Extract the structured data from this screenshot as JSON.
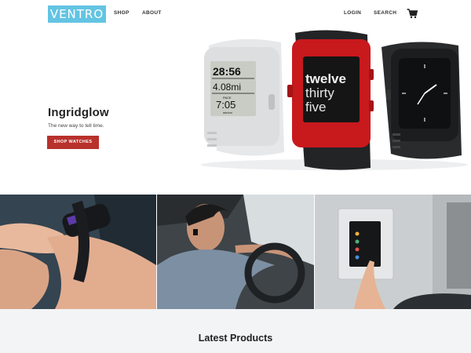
{
  "header": {
    "logo": "VENTRO",
    "nav": {
      "shop": "SHOP",
      "about": "ABOUT",
      "login": "LOGIN",
      "search": "SEARCH"
    }
  },
  "hero": {
    "title": "Ingridglow",
    "subtitle": "The new way to tell time.",
    "button": "SHOP WATCHES",
    "white_watch": {
      "time": "28:56",
      "distance": "4.08mi",
      "pace_label": "PACE",
      "pace": "7:05",
      "pace_unit": "min/mi"
    },
    "red_watch": {
      "line1": "twelve",
      "line2": "thirty",
      "line3": "five"
    }
  },
  "colors": {
    "logo_bg": "#63c4e3",
    "button": "#b8312c",
    "red_watch": "#c8191d"
  },
  "latest": {
    "title": "Latest Products"
  }
}
